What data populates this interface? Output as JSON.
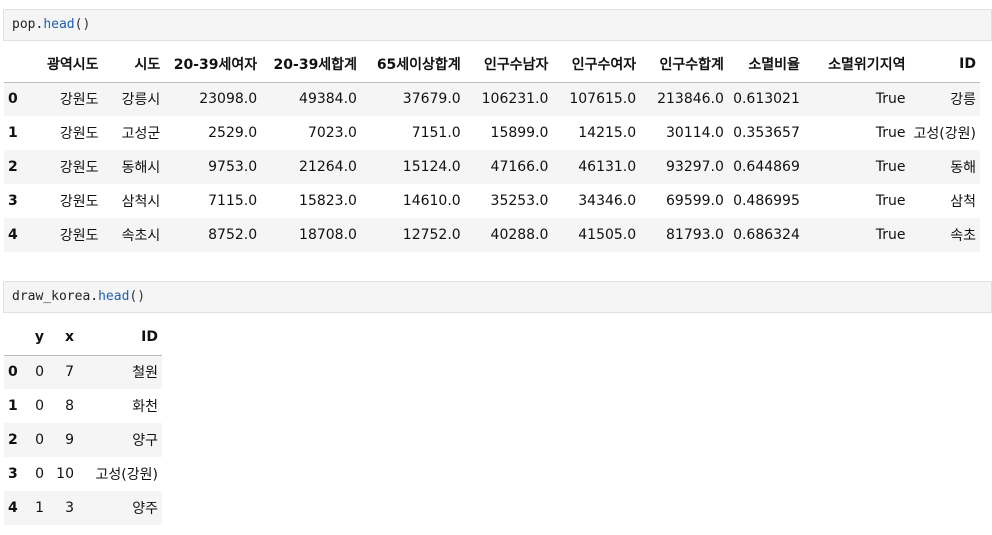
{
  "cell1": {
    "code_obj": "pop",
    "code_dot": ".",
    "code_method": "head",
    "code_paren": "()"
  },
  "table1": {
    "columns": [
      "광역시도",
      "시도",
      "20-39세여자",
      "20-39세합계",
      "65세이상합계",
      "인구수남자",
      "인구수여자",
      "인구수합계",
      "소멸비율",
      "소멸위기지역",
      "ID"
    ],
    "rows": [
      {
        "index": "0",
        "cells": [
          "강원도",
          "강릉시",
          "23098.0",
          "49384.0",
          "37679.0",
          "106231.0",
          "107615.0",
          "213846.0",
          "0.613021",
          "True",
          "강릉"
        ]
      },
      {
        "index": "1",
        "cells": [
          "강원도",
          "고성군",
          "2529.0",
          "7023.0",
          "7151.0",
          "15899.0",
          "14215.0",
          "30114.0",
          "0.353657",
          "True",
          "고성(강원)"
        ]
      },
      {
        "index": "2",
        "cells": [
          "강원도",
          "동해시",
          "9753.0",
          "21264.0",
          "15124.0",
          "47166.0",
          "46131.0",
          "93297.0",
          "0.644869",
          "True",
          "동해"
        ]
      },
      {
        "index": "3",
        "cells": [
          "강원도",
          "삼척시",
          "7115.0",
          "15823.0",
          "14610.0",
          "35253.0",
          "34346.0",
          "69599.0",
          "0.486995",
          "True",
          "삼척"
        ]
      },
      {
        "index": "4",
        "cells": [
          "강원도",
          "속초시",
          "8752.0",
          "18708.0",
          "12752.0",
          "40288.0",
          "41505.0",
          "81793.0",
          "0.686324",
          "True",
          "속초"
        ]
      }
    ]
  },
  "cell2": {
    "code_obj": "draw_korea",
    "code_dot": ".",
    "code_method": "head",
    "code_paren": "()"
  },
  "table2": {
    "columns": [
      "y",
      "x",
      "ID"
    ],
    "rows": [
      {
        "index": "0",
        "cells": [
          "0",
          "7",
          "철원"
        ]
      },
      {
        "index": "1",
        "cells": [
          "0",
          "8",
          "화천"
        ]
      },
      {
        "index": "2",
        "cells": [
          "0",
          "9",
          "양구"
        ]
      },
      {
        "index": "3",
        "cells": [
          "0",
          "10",
          "고성(강원)"
        ]
      },
      {
        "index": "4",
        "cells": [
          "1",
          "3",
          "양주"
        ]
      }
    ]
  }
}
